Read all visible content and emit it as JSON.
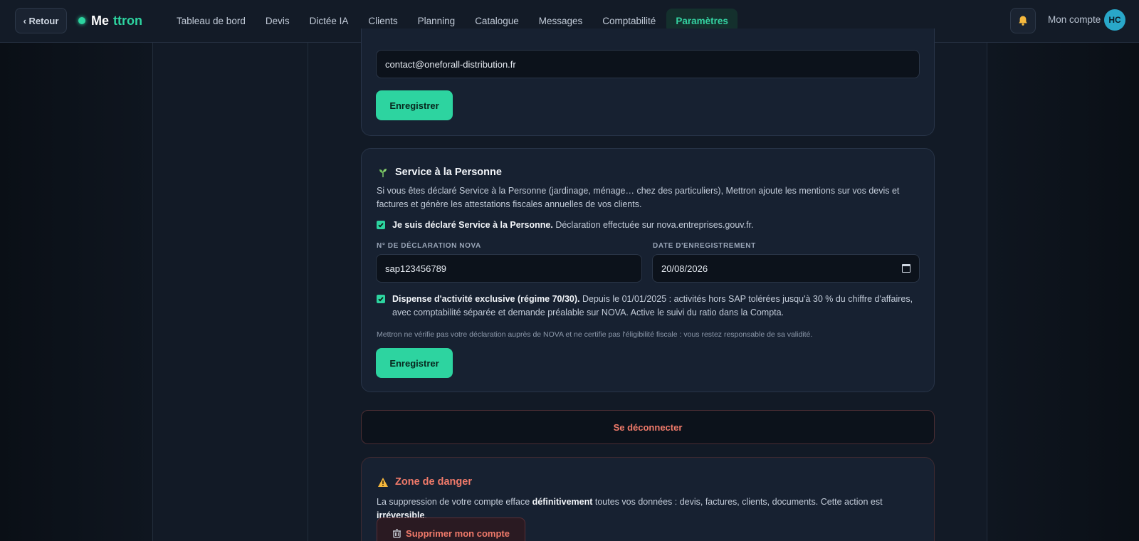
{
  "header": {
    "back_label": "‹ Retour",
    "brand_part1": "Me",
    "brand_part2": "ttron",
    "nav": [
      {
        "label": "Tableau de bord",
        "active": false
      },
      {
        "label": "Devis",
        "active": false
      },
      {
        "label": "Dictée IA",
        "active": false
      },
      {
        "label": "Clients",
        "active": false
      },
      {
        "label": "Planning",
        "active": false
      },
      {
        "label": "Catalogue",
        "active": false
      },
      {
        "label": "Messages",
        "active": false
      },
      {
        "label": "Comptabilité",
        "active": false
      },
      {
        "label": "Paramètres",
        "active": true
      }
    ],
    "account_label": "Mon compte",
    "avatar_initials": "HC"
  },
  "contact_card": {
    "email_value": "contact@oneforall-distribution.fr",
    "save_label": "Enregistrer"
  },
  "sap_card": {
    "title": "Service à la Personne",
    "description": "Si vous êtes déclaré Service à la Personne (jardinage, ménage… chez des particuliers), Mettron ajoute les mentions sur vos devis et factures et génère les attestations fiscales annuelles de vos clients.",
    "declared_checked": true,
    "declared_bold": "Je suis déclaré Service à la Personne.",
    "declared_rest": " Déclaration effectuée sur nova.entreprises.gouv.fr.",
    "nova_label": "N° DE DÉCLARATION NOVA",
    "nova_value": "sap123456789",
    "date_label": "DATE D'ENREGISTREMENT",
    "date_value": "20/08/2026",
    "exclusive_checked": true,
    "exclusive_bold": "Dispense d'activité exclusive (régime 70/30).",
    "exclusive_rest": " Depuis le 01/01/2025 : activités hors SAP tolérées jusqu'à 30 % du chiffre d'affaires, avec comptabilité séparée et demande préalable sur NOVA. Active le suivi du ratio dans la Compta.",
    "disclaimer": "Mettron ne vérifie pas votre déclaration auprès de NOVA et ne certifie pas l'éligibilité fiscale : vous restez responsable de sa validité.",
    "save_label": "Enregistrer"
  },
  "logout_label": "Se déconnecter",
  "danger": {
    "title": "Zone de danger",
    "text_1": "La suppression de votre compte efface ",
    "text_bold_1": "définitivement",
    "text_2": " toutes vos données : devis, factures, clients, documents. Cette action est ",
    "text_bold_2": "irréversible",
    "text_3": ".",
    "delete_label": "Supprimer mon compte"
  },
  "colors": {
    "accent": "#2dd4a0",
    "danger": "#f07a6a",
    "background": "#0b1119",
    "card": "#172131"
  }
}
